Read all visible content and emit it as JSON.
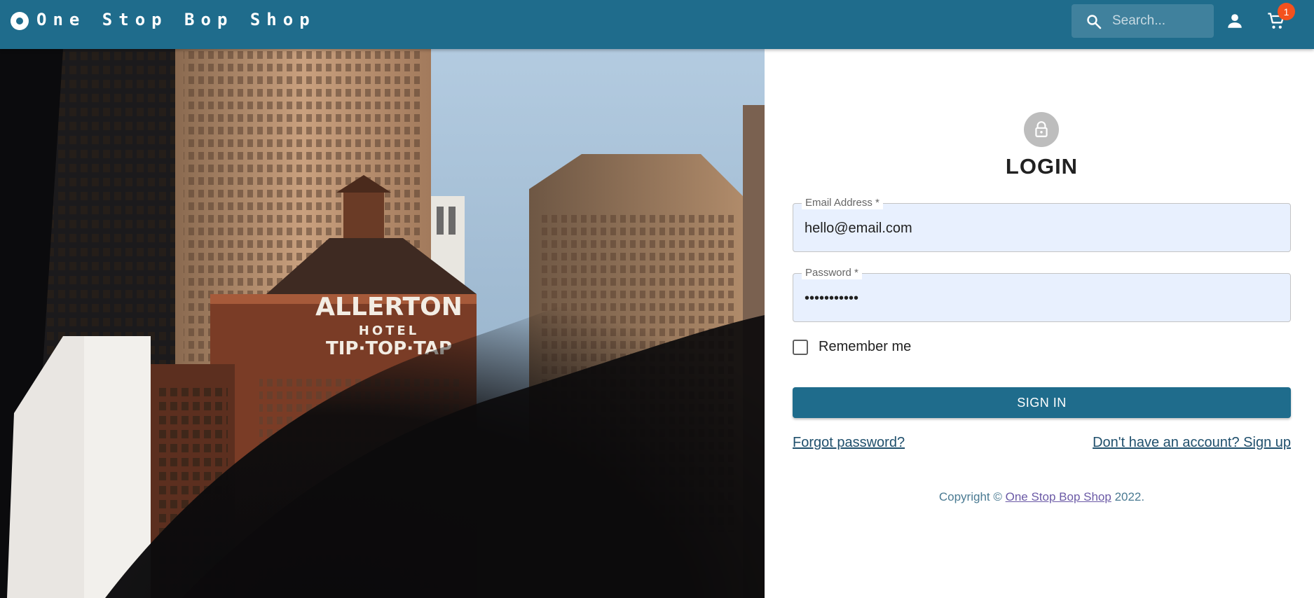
{
  "app": {
    "brand_title": "One Stop Bop Shop",
    "search_placeholder": "Search...",
    "cart_count": "1",
    "colors": {
      "appbar": "#1f6c8c",
      "badge": "#f4511e",
      "field_fill": "#e8f0fe"
    }
  },
  "hero": {
    "sign_text_1": "ALLERTON",
    "sign_text_2": "HOTEL",
    "sign_text_3": "TIP·TOP·TAP"
  },
  "login": {
    "title": "LOGIN",
    "email_label": "Email Address",
    "email_value": "hello@email.com",
    "password_label": "Password",
    "password_value": "•••••••••••",
    "required_mark": "*",
    "remember_label": "Remember me",
    "signin_label": "SIGN IN",
    "forgot_link": "Forgot password?",
    "signup_link": "Don't have an account? Sign up",
    "copyright_prefix": "Copyright © ",
    "copyright_link": "One Stop Bop Shop",
    "copyright_suffix": " 2022."
  },
  "icons": {
    "brand": "vinyl-record-icon",
    "search": "search-icon",
    "account": "person-icon",
    "cart": "shopping-cart-icon",
    "lock": "lock-icon"
  }
}
